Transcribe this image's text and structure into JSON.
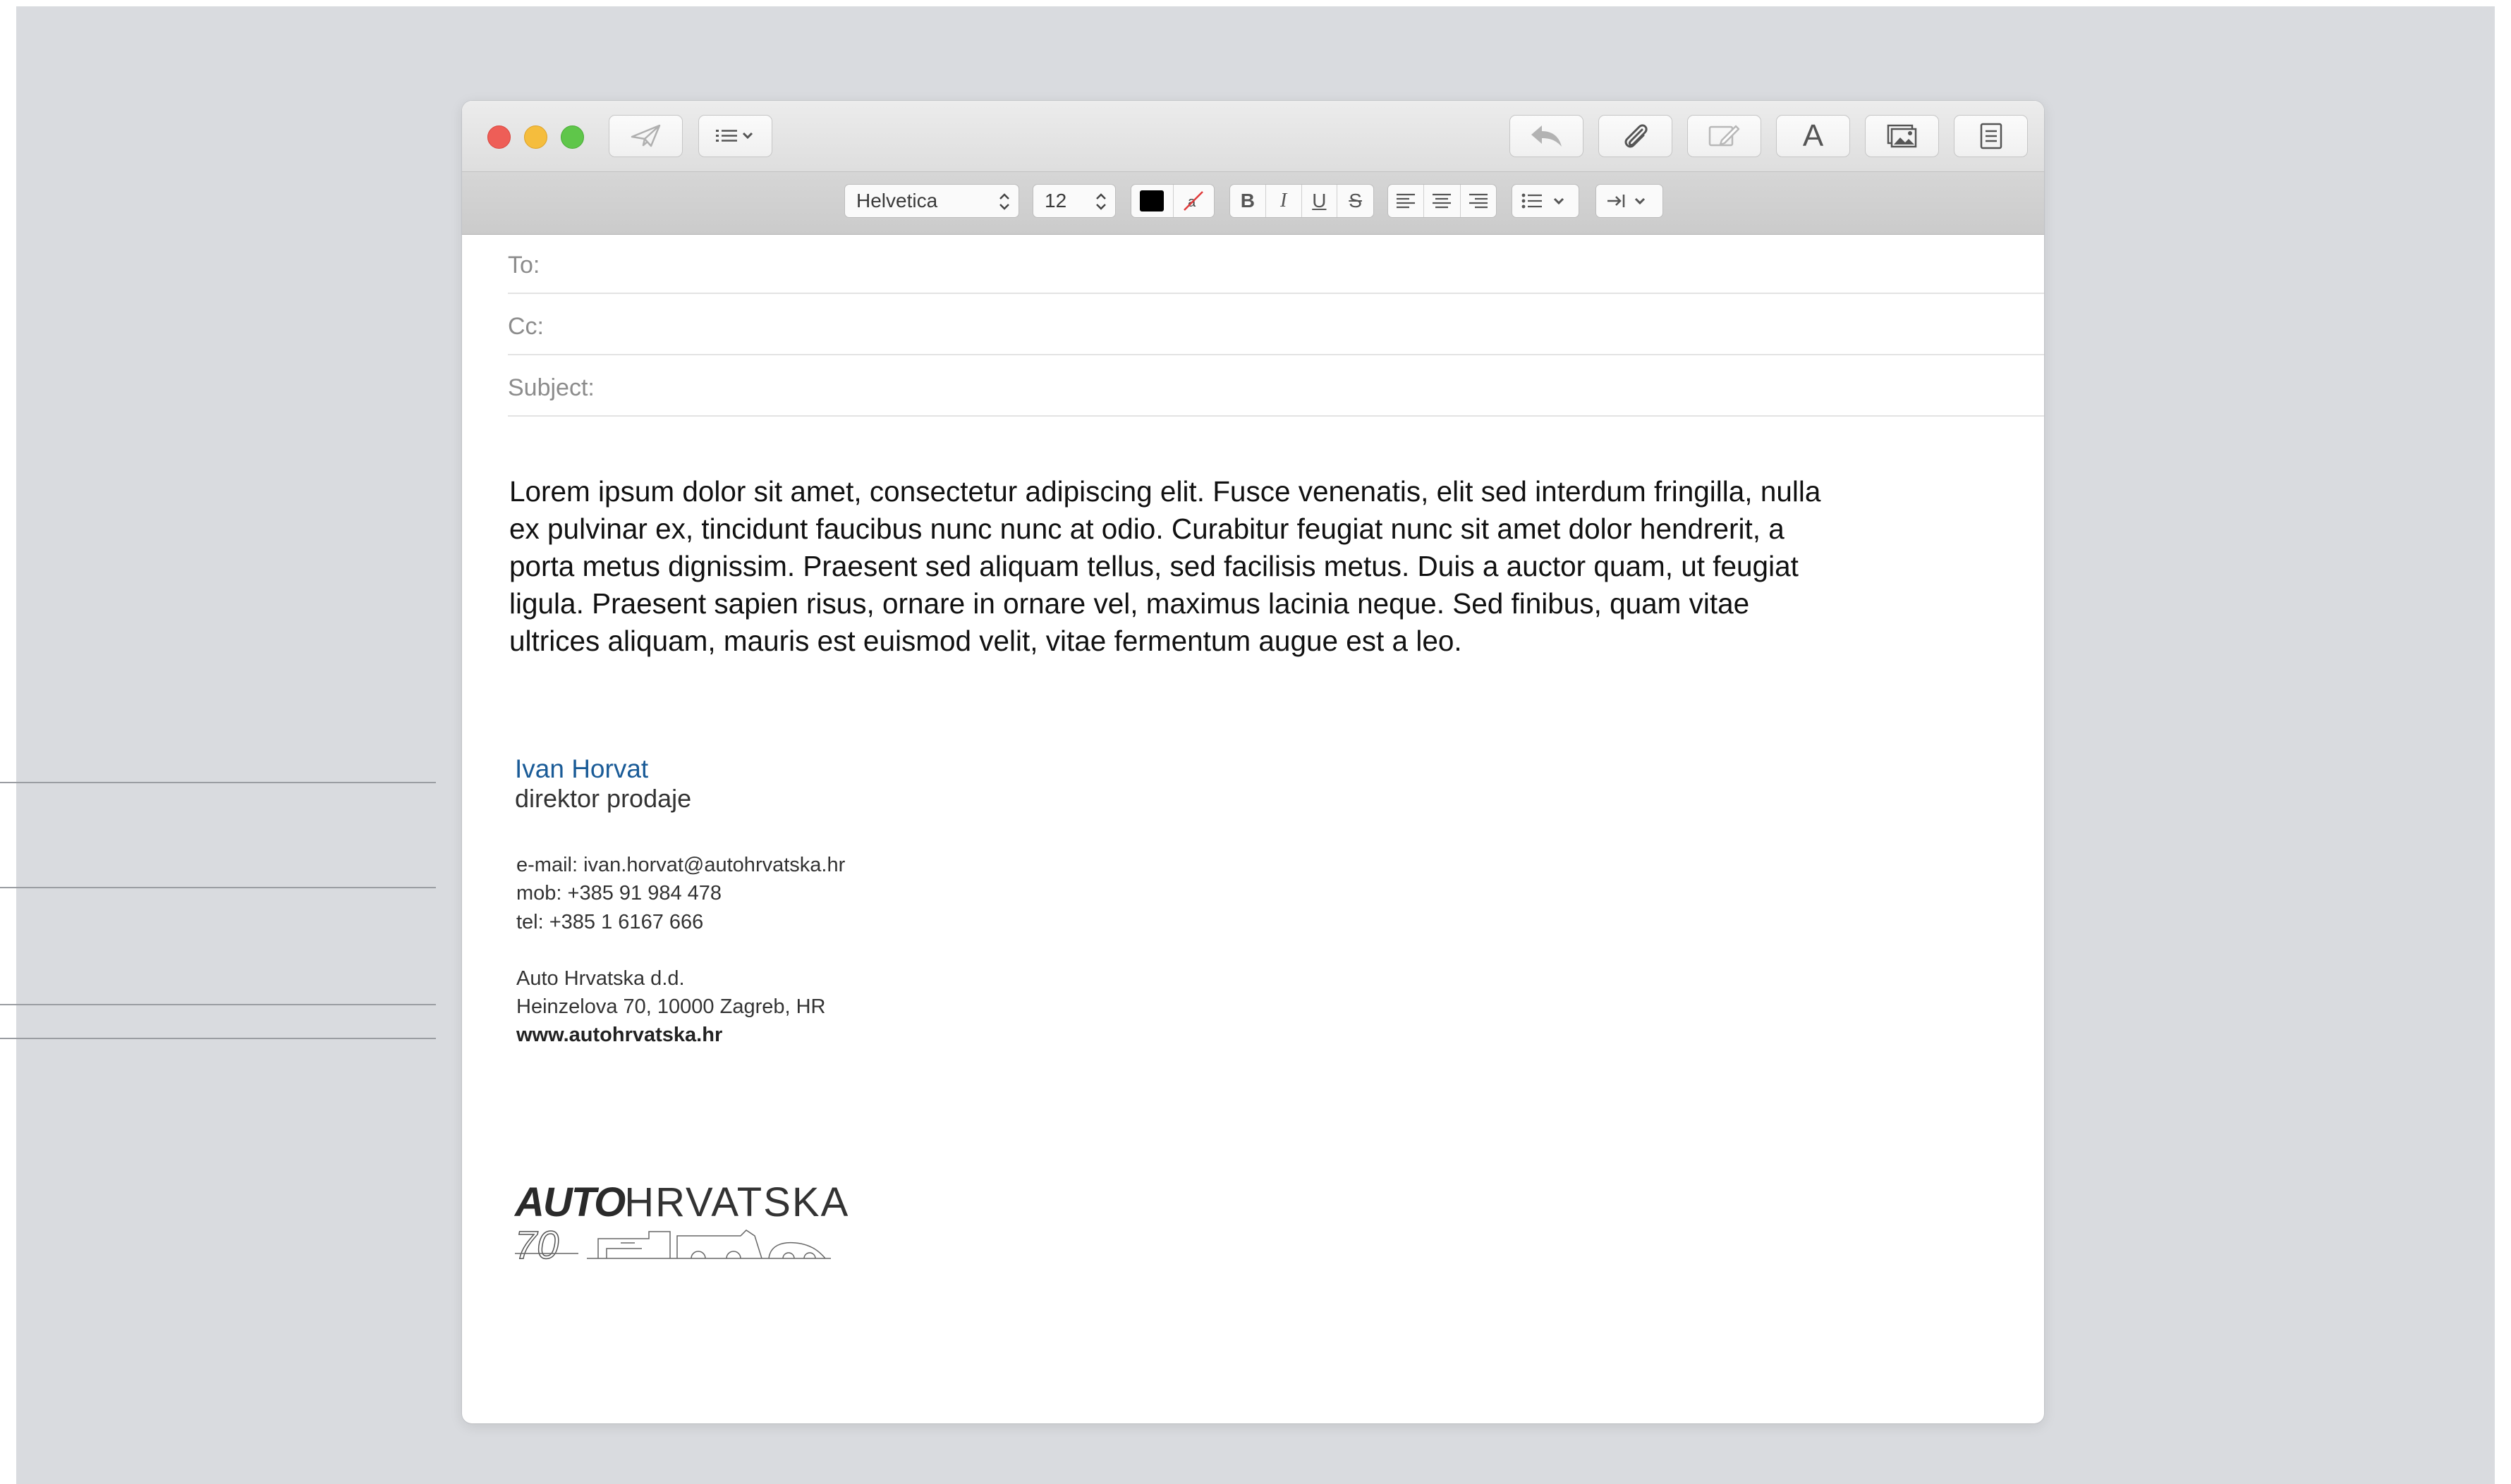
{
  "toolbar": {
    "send_icon": "paper-plane-icon",
    "header_fields_icon": "list-icon",
    "reply_icon": "reply-arrow-icon",
    "attach_icon": "paperclip-icon",
    "markup_icon": "markup-pen-icon",
    "fonts_label": "A",
    "photo_icon": "photo-browser-icon",
    "stationery_icon": "stationery-icon"
  },
  "format_bar": {
    "font_family": "Helvetica",
    "font_size": "12",
    "text_color": "#000000",
    "bold": "B",
    "italic": "I",
    "underline": "U",
    "strikethrough": "S"
  },
  "fields": {
    "to_label": "To:",
    "to_value": "",
    "cc_label": "Cc:",
    "cc_value": "",
    "subject_label": "Subject:",
    "subject_value": ""
  },
  "body": {
    "text": "Lorem ipsum dolor sit amet, consectetur adipiscing elit. Fusce venenatis, elit sed interdum fringilla, nulla ex pulvinar ex, tincidunt faucibus nunc nunc at odio. Curabitur feugiat nunc sit amet dolor hendrerit, a porta metus dignissim. Praesent sed aliquam tellus, sed facilisis metus. Duis a auctor quam, ut feugiat ligula. Praesent sapien risus, ornare in ornare vel, maximus lacinia neque. Sed finibus, quam vitae ultrices aliquam, mauris est euismod velit, vitae fermentum augue est a leo."
  },
  "signature": {
    "name": "Ivan Horvat",
    "title": "direktor prodaje",
    "email": "e-mail: ivan.horvat@autohrvatska.hr",
    "mobile": "mob: +385 91 984 478",
    "phone": "tel: +385 1 6167 666",
    "company": "Auto Hrvatska d.d.",
    "address": "Heinzelova 70, 10000 Zagreb, HR",
    "website": "www.autohrvatska.hr",
    "logo_bold": "AUTO",
    "logo_light": "HRVATSKA",
    "logo_anniversary": "70"
  },
  "colors": {
    "close": "#ee5e57",
    "minimize": "#f5bd3d",
    "zoom": "#5fc64a",
    "signature_name": "#1a5b97"
  }
}
